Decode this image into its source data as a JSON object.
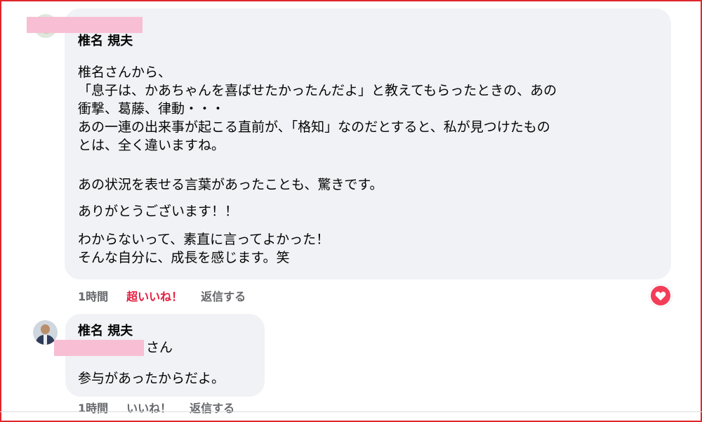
{
  "comment1": {
    "author": "椎名 規夫",
    "paragraphs": [
      [
        "椎名さんから、",
        "「息子は、かあちゃんを喜ばせたかったんだよ」と教えてもらったときの、あの",
        "衝撃、葛藤、律動・・・",
        "あの一連の出来事が起こる直前が、「格知」なのだとすると、私が見つけたもの",
        "とは、全く違いますね。"
      ],
      [
        "あの状況を表せる言葉があったことも、驚きです。"
      ],
      [
        "ありがとうございます！！"
      ],
      [
        "わからないって、素直に言ってよかった！",
        "そんな自分に、成長を感じます。笑"
      ]
    ],
    "actions": {
      "time": "1時間",
      "like": "超いいね！",
      "reply": "返信する"
    },
    "reaction_icon": "heart-icon",
    "colors": {
      "like": "#e41e3f",
      "heart": "#f33e58"
    }
  },
  "comment2": {
    "author": "椎名 規夫",
    "salutation": "さん",
    "text": "参与があったからだよ。",
    "actions": {
      "time": "1時間",
      "like": "いいね！",
      "reply": "返信する"
    }
  }
}
